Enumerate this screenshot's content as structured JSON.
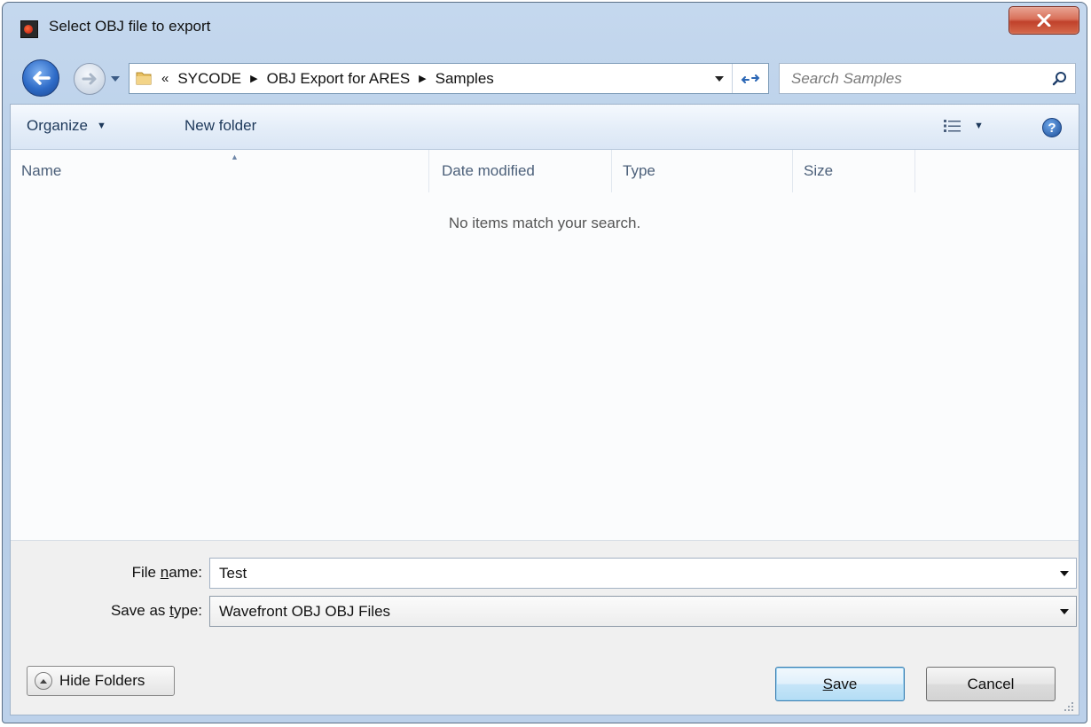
{
  "window": {
    "title": "Select OBJ file to export"
  },
  "address": {
    "overflow_glyph": "«",
    "crumbs": [
      "SYCODE",
      "OBJ Export for ARES",
      "Samples"
    ]
  },
  "search": {
    "placeholder": "Search Samples"
  },
  "toolbar": {
    "organize": "Organize",
    "new_folder": "New folder"
  },
  "columns": {
    "name": "Name",
    "date": "Date modified",
    "type": "Type",
    "size": "Size"
  },
  "empty_message": "No items match your search.",
  "file_name": {
    "label_pre": "File ",
    "label_key": "n",
    "label_post": "ame:",
    "value": "Test"
  },
  "save_type": {
    "label_pre": "Save as ",
    "label_key": "t",
    "label_post": "ype:",
    "value": "Wavefront OBJ OBJ Files"
  },
  "buttons": {
    "hide_folders": "Hide Folders",
    "save_key": "S",
    "save_rest": "ave",
    "cancel": "Cancel"
  },
  "icons": {
    "app": "app-icon",
    "close": "close-icon",
    "back": "back-arrow-icon",
    "forward": "forward-arrow-icon",
    "folder": "folder-icon",
    "refresh": "refresh-icon",
    "search": "search-icon",
    "views": "views-icon",
    "help": "help-icon",
    "collapse": "chevron-up-icon"
  }
}
